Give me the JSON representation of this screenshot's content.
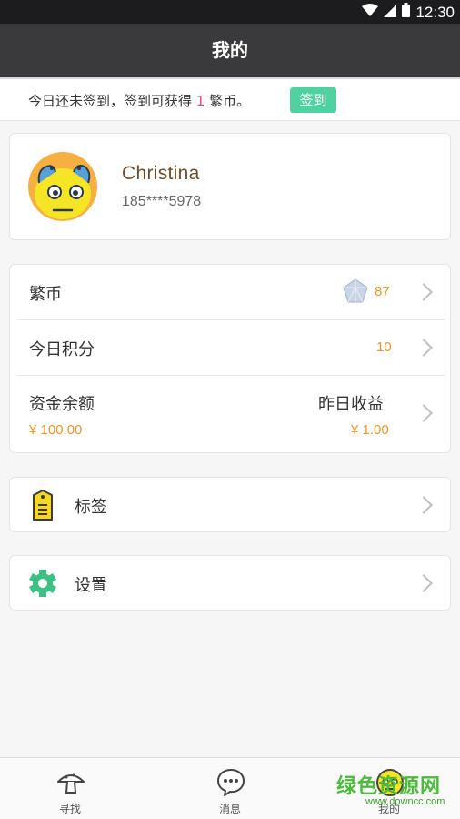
{
  "status_bar": {
    "time": "12:30"
  },
  "header": {
    "title": "我的"
  },
  "signin": {
    "text_before": "今日还未签到，签到可获得 ",
    "coin_amount": "1",
    "text_after": " 繁币。",
    "button_label": "签到"
  },
  "profile": {
    "name": "Christina",
    "phone": "185****5978"
  },
  "stats": {
    "coins_label": "繁币",
    "coins_value": "87",
    "points_label": "今日积分",
    "points_value": "10",
    "balance_label": "资金余额",
    "balance_value": "¥ 100.00",
    "yesterday_label": "昨日收益",
    "yesterday_value": "¥ 1.00"
  },
  "menu": [
    {
      "label": "标签",
      "icon": "tag-icon"
    },
    {
      "label": "设置",
      "icon": "gear-icon"
    }
  ],
  "tabs": [
    {
      "label": "寻找",
      "icon": "mushroom-icon"
    },
    {
      "label": "消息",
      "icon": "chat-bubble-icon"
    },
    {
      "label": "我的",
      "icon": "profile-face-icon"
    }
  ],
  "watermark": {
    "brand": "绿色资源网",
    "url": "www.downcc.com"
  },
  "colors": {
    "accent_green": "#4fd1a0",
    "value_orange": "#e8962e",
    "nav_dark": "#3a3a3c"
  }
}
